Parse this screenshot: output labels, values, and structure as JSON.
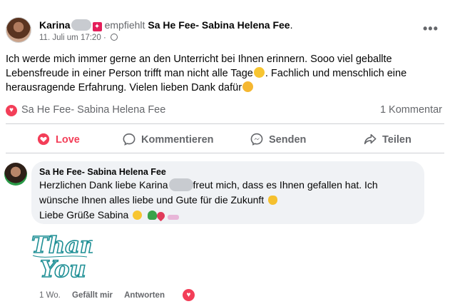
{
  "post": {
    "author": "Karina",
    "recommends_text": "empfiehlt",
    "page_name": "Sa He Fee- Sabina Helena Fee",
    "page_name_suffix": ".",
    "timestamp": "11. Juli um 17:20",
    "timestamp_sep": "·",
    "more_icon": "more-horizontal-icon",
    "body_line1": "Ich werde mich immer gerne an den Unterricht bei Ihnen erinnern. Sooo viel geballte",
    "body_line2a": "Lebensfreude in einer Person trifft man nicht alle Tage",
    "body_line2b": ". Fachlich und menschlich eine",
    "body_line3": "herausragende Erfahrung. Vielen lieben Dank dafür"
  },
  "reactions": {
    "icon": "love-reaction-icon",
    "reactor": "Sa He Fee- Sabina Helena Fee",
    "comment_count": "1 Kommentar"
  },
  "actions": {
    "love": "Love",
    "comment": "Kommentieren",
    "share": "Senden",
    "forward": "Teilen"
  },
  "comment": {
    "author": "Sa He Fee- Sabina Helena Fee",
    "line1a": "Herzlichen Dank liebe Karina",
    "line1b": "freut mich, dass es Ihnen gefallen hat. Ich",
    "line2": "wünsche Ihnen alles liebe und Gute für die Zukunft",
    "line3": "Liebe Grüße Sabina",
    "sticker_line1": "Thank",
    "sticker_line2": "You",
    "age": "1 Wo.",
    "like": "Gefällt mir",
    "reply": "Antworten"
  },
  "colors": {
    "love": "#f33e58",
    "secondary_text": "#65676b",
    "bubble": "#f0f2f5",
    "sticker_teal": "#1e8f95"
  }
}
